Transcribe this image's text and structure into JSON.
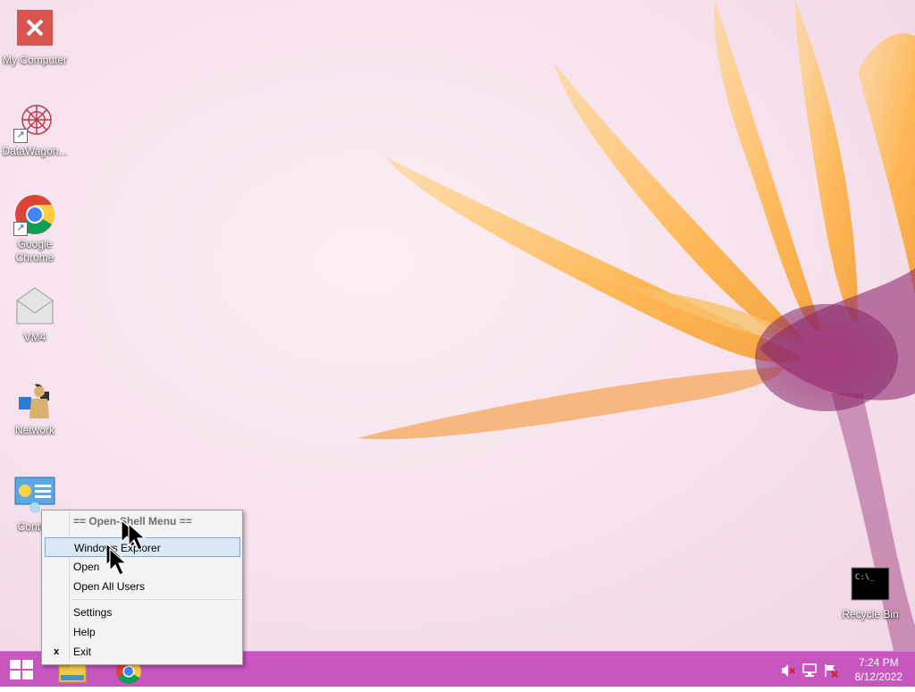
{
  "desktop": {
    "icons": [
      {
        "label": "My Computer",
        "icon": "error-x-icon"
      },
      {
        "label": "DataWagon...",
        "icon": "datawagon-logo-icon"
      },
      {
        "label": "Google Chrome",
        "icon": "chrome-icon"
      },
      {
        "label": "VM4",
        "icon": "mail-envelope-icon"
      },
      {
        "label": "Network",
        "icon": "network-puzzle-icon"
      },
      {
        "label": "Control",
        "icon": "control-panel-icon"
      },
      {
        "label": "Recycle Bin",
        "icon": "command-prompt-icon"
      }
    ]
  },
  "context_menu": {
    "header": "== Open-Shell Menu ==",
    "items": [
      {
        "label": "Windows Explorer",
        "highlighted": true
      },
      {
        "label": "Open"
      },
      {
        "label": "Open All Users"
      },
      {
        "label": "Settings"
      },
      {
        "label": "Help"
      },
      {
        "label": "Exit",
        "mark": "x"
      }
    ]
  },
  "taskbar": {
    "start_icon": "windows-logo-icon",
    "pinned": [
      "file-explorer-icon",
      "chrome-icon"
    ],
    "tray": [
      "volume-muted-icon",
      "network-icon",
      "action-center-flag-icon"
    ],
    "clock": {
      "time": "7:24 PM",
      "date": "8/12/2022"
    },
    "color": "#c756bf"
  }
}
